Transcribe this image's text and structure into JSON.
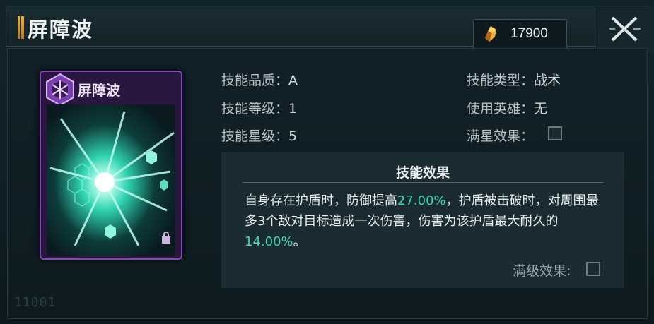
{
  "header": {
    "title": "屏障波",
    "currency_value": "17900",
    "currency_icon": "crystal-icon",
    "close_icon": "close-icon"
  },
  "card": {
    "name": "屏障波",
    "emblem_icon": "hexagon-emblem-icon",
    "art": "energy-burst-art",
    "frame_color": "#7d4ab3"
  },
  "watermark": "11001",
  "info": {
    "quality_label": "技能品质：",
    "quality_value": "A",
    "level_label": "技能等级：",
    "level_value": "1",
    "star_label": "技能星级：",
    "star_value": "5",
    "type_label": "技能类型：",
    "type_value": "战术",
    "hero_label": "使用英雄：",
    "hero_value": "无",
    "maxstar_label": "满星效果："
  },
  "effect": {
    "title": "技能效果",
    "text_part1": "自身存在护盾时，防御提高",
    "highlight1": "27.00%",
    "text_part2": "，护盾被击破时，对周围最多3个敌对目标造成一次伤害，伤害为该护盾最大耐久的",
    "highlight2": "14.00%",
    "text_part3": "。",
    "maxlevel_label": "满级效果:",
    "highlight_color": "#3ed9b0"
  }
}
